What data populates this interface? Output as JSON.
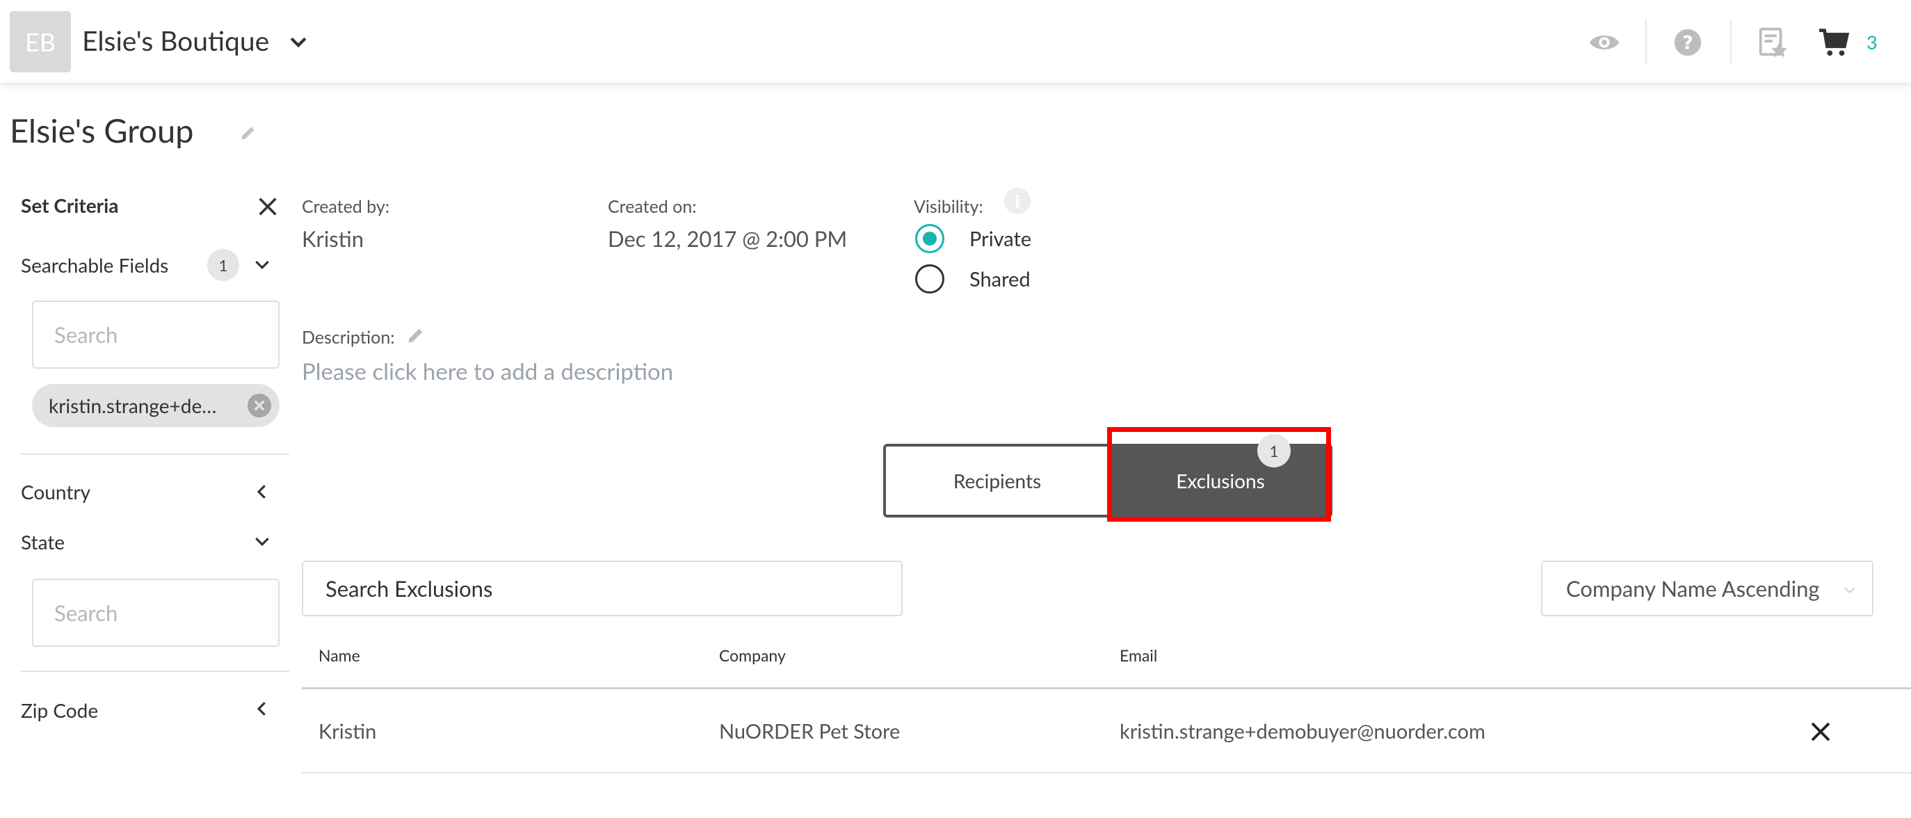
{
  "header": {
    "avatar_initials": "EB",
    "store_name": "Elsie's Boutique",
    "cart_count": "3",
    "icons": [
      "eye-icon",
      "help-icon",
      "catalog-icon",
      "cart-icon"
    ]
  },
  "page": {
    "title": "Elsie's Group"
  },
  "sidebar": {
    "heading": "Set Criteria",
    "searchable_fields_label": "Searchable Fields",
    "searchable_fields_count": "1",
    "search_placeholder": "Search",
    "chip_text": "kristin.strange+demobuyer@nuorder.com",
    "country_label": "Country",
    "state_label": "State",
    "state_search_placeholder": "Search",
    "zip_label": "Zip Code"
  },
  "meta": {
    "created_by_label": "Created by:",
    "created_by_value": "Kristin",
    "created_on_label": "Created on:",
    "created_on_value": "Dec 12, 2017 @ 2:00 PM",
    "visibility_label": "Visibility:",
    "visibility_info": "i",
    "visibility_options": [
      "Private",
      "Shared"
    ],
    "visibility_selected": "Private",
    "description_label": "Description:",
    "description_placeholder": "Please click here to add a description"
  },
  "tabs": {
    "recipients_label": "Recipients",
    "exclusions_label": "Exclusions",
    "exclusions_count": "1",
    "active": "Exclusions"
  },
  "exclusions": {
    "search_placeholder": "Search Exclusions",
    "sort_value": "Company Name Ascending",
    "columns": [
      "Name",
      "Company",
      "Email"
    ],
    "rows": [
      {
        "name": "Kristin",
        "company": "NuORDER Pet Store",
        "email": "kristin.strange+demobuyer@nuorder.com"
      }
    ]
  },
  "colors": {
    "accent": "#19b3b3",
    "tab_active": "#565656",
    "highlight": "#ff0000"
  }
}
